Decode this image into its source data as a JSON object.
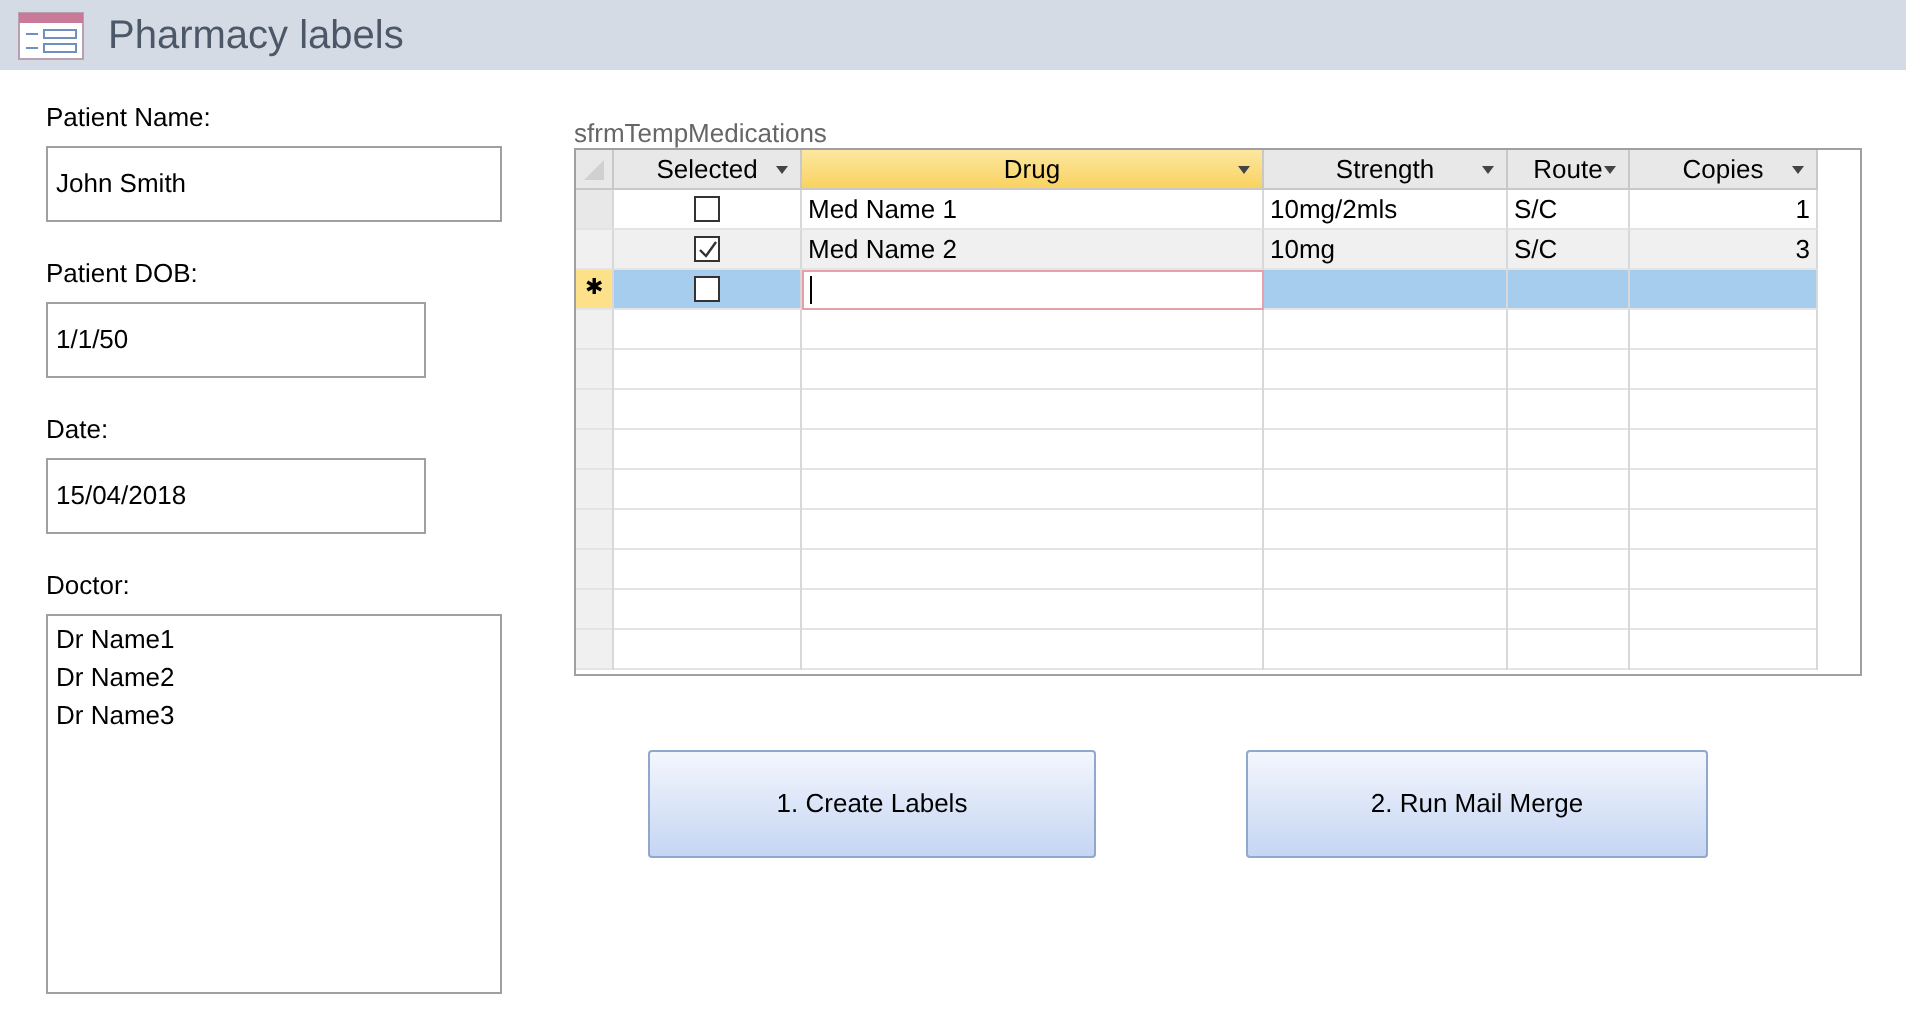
{
  "window": {
    "title": "Pharmacy labels"
  },
  "fields": [
    {
      "label": "Patient Name:",
      "value": "John Smith"
    },
    {
      "label": "Patient DOB:",
      "value": "1/1/50"
    },
    {
      "label": "Date:",
      "value": "15/04/2018"
    }
  ],
  "doctor": {
    "label": "Doctor:",
    "items": [
      "Dr Name1",
      "Dr Name2",
      "Dr Name3"
    ]
  },
  "subform": {
    "caption": "sfrmTempMedications",
    "columns": [
      {
        "label": "Selected",
        "selected": false
      },
      {
        "label": "Drug",
        "selected": true
      },
      {
        "label": "Strength",
        "selected": false
      },
      {
        "label": "Route",
        "selected": false
      },
      {
        "label": "Copies",
        "selected": false
      }
    ],
    "rows": [
      {
        "checked": false,
        "drug": "Med Name 1",
        "strength": "10mg/2mls",
        "route": "S/C",
        "copies": "1",
        "selected": false
      },
      {
        "checked": true,
        "drug": "Med Name 2",
        "strength": "10mg",
        "route": "S/C",
        "copies": "3",
        "selected": false
      },
      {
        "checked": false,
        "marker": "✱",
        "selected": true
      }
    ]
  },
  "buttons": [
    "1. Create Labels",
    "2. Run Mail Merge"
  ]
}
